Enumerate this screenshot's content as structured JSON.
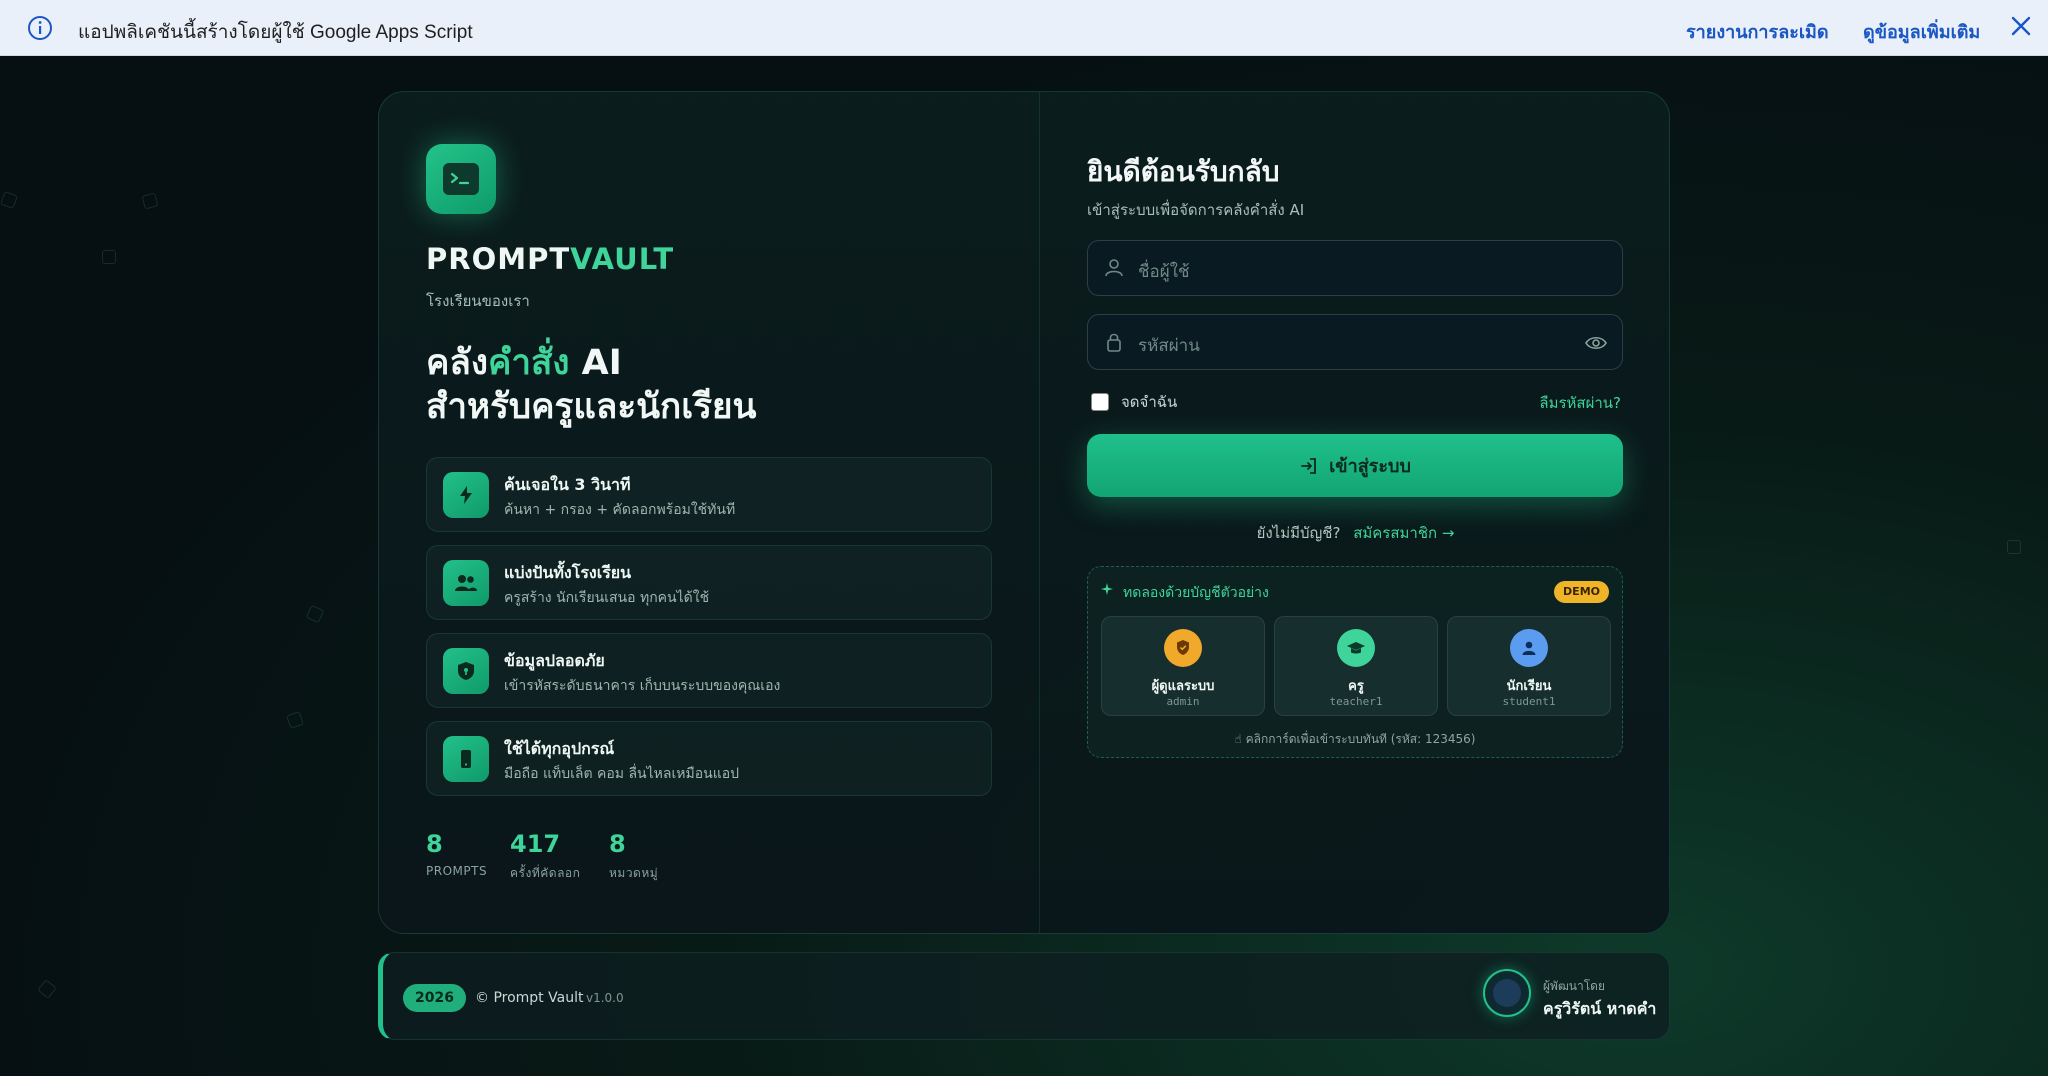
{
  "banner": {
    "message": "แอปพลิเคชันนี้สร้างโดยผู้ใช้ Google Apps Script",
    "report_link": "รายงานการละเมิด",
    "more_link": "ดูข้อมูลเพิ่มเติม"
  },
  "brand": {
    "name_part1": "PROMPT",
    "name_part2": "VAULT",
    "school": "โรงเรียนของเรา",
    "headline_part1": "คลัง",
    "headline_accent": "คำสั่ง",
    "headline_part2": " AI",
    "headline_line2": "สำหรับครูและนักเรียน"
  },
  "features": [
    {
      "title": "ค้นเจอใน 3 วินาที",
      "desc": "ค้นหา + กรอง + คัดลอกพร้อมใช้ทันที",
      "icon": "lightning-icon"
    },
    {
      "title": "แบ่งปันทั้งโรงเรียน",
      "desc": "ครูสร้าง นักเรียนเสนอ ทุกคนได้ใช้",
      "icon": "users-icon"
    },
    {
      "title": "ข้อมูลปลอดภัย",
      "desc": "เข้ารหัสระดับธนาคาร เก็บบนระบบของคุณเอง",
      "icon": "shield-icon"
    },
    {
      "title": "ใช้ได้ทุกอุปกรณ์",
      "desc": "มือถือ แท็บเล็ต คอม ลื่นไหลเหมือนแอป",
      "icon": "phone-icon"
    }
  ],
  "stats": [
    {
      "value": "8",
      "label": "PROMPTS"
    },
    {
      "value": "417",
      "label": "ครั้งที่คัดลอก"
    },
    {
      "value": "8",
      "label": "หมวดหมู่"
    }
  ],
  "login": {
    "title": "ยินดีต้อนรับกลับ",
    "subtitle": "เข้าสู่ระบบเพื่อจัดการคลังคำสั่ง AI",
    "username_placeholder": "ชื่อผู้ใช้",
    "password_placeholder": "รหัสผ่าน",
    "remember_label": "จดจำฉัน",
    "forgot_label": "ลืมรหัสผ่าน?",
    "submit_label": "เข้าสู่ระบบ",
    "no_account": "ยังไม่มีบัญชี?",
    "register_link": "สมัครสมาชิก →"
  },
  "demo": {
    "title": "ทดลองด้วยบัญชีตัวอย่าง",
    "badge": "DEMO",
    "accounts": [
      {
        "name": "ผู้ดูแลระบบ",
        "username": "admin",
        "color": "#f0a92a",
        "icon": "shield-icon"
      },
      {
        "name": "ครู",
        "username": "teacher1",
        "color": "#3fd49a",
        "icon": "graduation-cap-icon"
      },
      {
        "name": "นักเรียน",
        "username": "student1",
        "color": "#5b9cf0",
        "icon": "user-icon"
      }
    ],
    "hint": "คลิกการ์ดเพื่อเข้าระบบทันที (รหัส: 123456)"
  },
  "footer": {
    "year": "2026",
    "copyright": "© Prompt Vault",
    "version": "v1.0.0",
    "dev_label": "ผู้พัฒนาโดย",
    "dev_name": "ครูวิรัตน์ หาดคำ"
  },
  "colors": {
    "accent": "#3fd49a",
    "banner_link": "#1a57c4",
    "demo_badge": "#f0b429"
  }
}
